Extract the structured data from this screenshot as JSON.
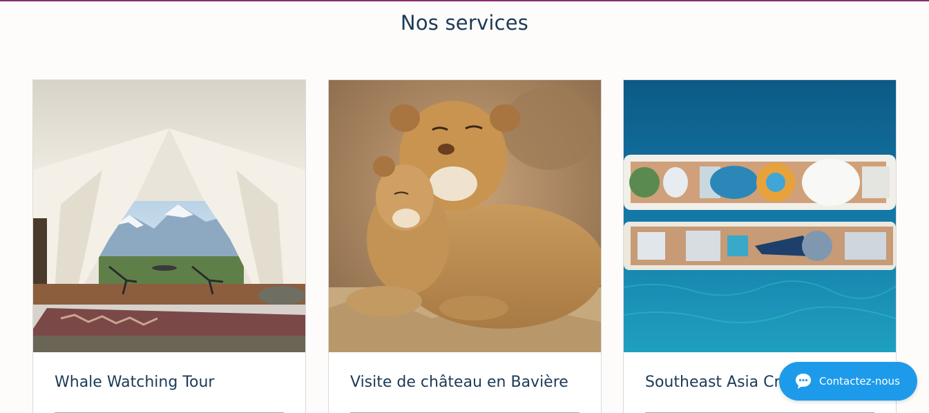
{
  "page": {
    "title": "Nos services"
  },
  "services": [
    {
      "title": "Whale Watching Tour",
      "image": "glamping-tent-mountain-view-image"
    },
    {
      "title": "Visite de château en Bavière",
      "image": "lioness-and-cub-image"
    },
    {
      "title": "Southeast Asia Cruise",
      "image": "cruise-ship-aerial-image"
    }
  ],
  "chat": {
    "label": "Contactez-nous",
    "icon": "chat-bubble-icon"
  },
  "colors": {
    "accent_line": "#8a2a6f",
    "text": "#1c3a57",
    "chat_button": "#1d9bea"
  }
}
